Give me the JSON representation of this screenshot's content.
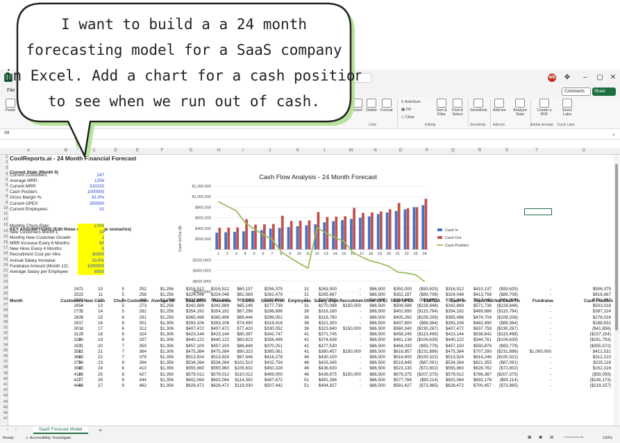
{
  "bubble": {
    "lines": [
      "I want to build a a 24 month",
      "forecasting model for a SaaS company",
      "in Excel. Add a chart for a cash position",
      "to see when we run out of cash."
    ]
  },
  "window": {
    "avatar": "WB",
    "comments": "Comments",
    "share": "Share",
    "file_menu": "File",
    "namebox": "S9"
  },
  "ribbon": {
    "paste": "Paste",
    "insert": "Insert",
    "delete": "Delete",
    "format": "Format",
    "cells": "Cells",
    "autosum": "AutoSum",
    "fill": "Fill",
    "clear": "Clear",
    "sort_filter": "Sort & Filter",
    "find_select": "Find & Select",
    "editing": "Editing",
    "sensitivity": "Sensitivity",
    "sensitivity_group": "Sensitivity",
    "addins": "Add-ins",
    "addins_group": "Add-ins",
    "analyze": "Analyze Data",
    "create_pdf": "Create a PDF",
    "excel_labs": "Excel Labs",
    "adobe_group": "Adobe Acrobat",
    "labs_group": "Excel Labs"
  },
  "columns": [
    "A",
    "B",
    "C",
    "D",
    "E",
    "F",
    "G",
    "H",
    "I",
    "J",
    "K",
    "L",
    "M",
    "N",
    "O",
    "P",
    "Q",
    "R",
    "S",
    "T",
    "U"
  ],
  "title": "CoolReports.ai - 24 Month Financial Forecast",
  "current_state": {
    "heading": "Current State (Month 0)",
    "rows": [
      {
        "label": "Current Customers:",
        "value": "247"
      },
      {
        "label": "Average MRR:",
        "value": "1256"
      },
      {
        "label": "Current MRR:",
        "value": "310232"
      },
      {
        "label": "Cash Position:",
        "value": "1000000"
      },
      {
        "label": "Gross Margin %:",
        "value": "81.0%"
      },
      {
        "label": "Current OPEX:",
        "value": "350000"
      },
      {
        "label": "Current Employees:",
        "value": "31"
      }
    ]
  },
  "assumptions": {
    "heading": "KEY ASSUMPTIONS (Edit these cells to change scenarios)",
    "rows": [
      {
        "label": "Monthly Churn Rate:",
        "value": "2.0%"
      },
      {
        "label": "New Customers Month 1:",
        "value": "10"
      },
      {
        "label": "Monthly New Customer Growth:",
        "value": "1"
      },
      {
        "label": "MRR Increase Every 6 Months:",
        "value": "50"
      },
      {
        "label": "New Hires Every 4 Months:",
        "value": "5"
      },
      {
        "label": "Recruitment Cost per Hire:",
        "value": "30000"
      },
      {
        "label": "Annual Salary Increase:",
        "value": "10.0%"
      },
      {
        "label": "Fundraise Amount (Month 12):",
        "value": "1000000"
      },
      {
        "label": "Average Salary per Employee:",
        "value": "8500"
      }
    ]
  },
  "table": {
    "headers": [
      "Month",
      "Customers",
      "New Custon",
      "Churn",
      "Customers",
      "Average MF",
      "Total MRR",
      "Revenue",
      "COGS",
      "Gross Profi",
      "Employees",
      "Salary Expe",
      "Recruitmen",
      "Other OPEX",
      "Total OPEX",
      "EBITDA",
      "Cash In",
      "Cash Out",
      "Net Cash Flc",
      "Fundraise",
      "Cash Position"
    ],
    "rows": [
      [
        "1",
        "247",
        "10",
        "5",
        "252",
        "$1,256",
        "$316,512",
        "$316,512",
        "$60,137",
        "$256,375",
        "31",
        "$263,500",
        "-",
        "$86,500",
        "$350,000",
        "($93,625)",
        "$316,512",
        "$410,137",
        "($93,625)",
        "-",
        "$906,375"
      ],
      [
        "2",
        "252",
        "11",
        "5",
        "258",
        "$1,256",
        "$324,048",
        "$324,048",
        "$61,569",
        "$262,479",
        "31",
        "$265,687",
        "-",
        "$86,500",
        "$352,187",
        "($89,708)",
        "$324,048",
        "$413,756",
        "($89,708)",
        "-",
        "$816,667"
      ],
      [
        "3",
        "258",
        "12",
        "5",
        "265",
        "$1,256",
        "$332,840",
        "$332,840",
        "$63,240",
        "$269,600",
        "31",
        "$267,900",
        "-",
        "$86,500",
        "$354,400",
        "($84,800)",
        "$332,840",
        "$417,640",
        "($84,800)",
        "-",
        "$731,867"
      ],
      [
        "4",
        "265",
        "13",
        "5",
        "273",
        "$1,256",
        "$342,888",
        "$342,888",
        "$65,149",
        "$277,739",
        "31",
        "$270,088",
        "$150,000",
        "$86,500",
        "$506,588",
        "($228,848)",
        "$342,888",
        "$571,736",
        "($228,848)",
        "-",
        "$503,018"
      ],
      [
        "5",
        "273",
        "14",
        "5",
        "282",
        "$1,256",
        "$354,192",
        "$354,192",
        "$67,296",
        "$286,896",
        "36",
        "$316,190",
        "-",
        "$86,500",
        "$402,690",
        "($115,794)",
        "$354,192",
        "$469,986",
        "($115,794)",
        "-",
        "$387,224"
      ],
      [
        "6",
        "282",
        "15",
        "6",
        "291",
        "$1,256",
        "$365,496",
        "$365,496",
        "$69,444",
        "$296,052",
        "36",
        "$318,760",
        "-",
        "$86,500",
        "$405,260",
        "($109,208)",
        "$365,496",
        "$474,704",
        "($109,208)",
        "-",
        "$278,016"
      ],
      [
        "7",
        "291",
        "16",
        "6",
        "301",
        "$1,306",
        "$393,106",
        "$393,106",
        "$74,690",
        "$318,416",
        "36",
        "$321,300",
        "-",
        "$86,500",
        "$407,800",
        "($89,384)",
        "$393,106",
        "$482,490",
        "($89,384)",
        "-",
        "$188,631"
      ],
      [
        "8",
        "301",
        "17",
        "6",
        "312",
        "$1,306",
        "$407,472",
        "$407,472",
        "$77,420",
        "$330,052",
        "36",
        "$323,840",
        "$150,000",
        "$86,500",
        "$560,340",
        "($230,287)",
        "$407,472",
        "$637,759",
        "($230,287)",
        "-",
        "($41,656)"
      ],
      [
        "9",
        "312",
        "18",
        "6",
        "324",
        "$1,306",
        "$423,144",
        "$423,144",
        "$80,397",
        "$342,747",
        "41",
        "$371,745",
        "-",
        "$86,500",
        "$458,245",
        "($115,498)",
        "$423,144",
        "$538,642",
        "($115,498)",
        "-",
        "($157,154)"
      ],
      [
        "10",
        "324",
        "19",
        "6",
        "337",
        "$1,306",
        "$440,122",
        "$440,122",
        "$83,623",
        "$356,499",
        "41",
        "$374,638",
        "-",
        "$86,500",
        "$461,138",
        "($104,639)",
        "$440,122",
        "$544,761",
        "($104,639)",
        "-",
        "($261,793)"
      ],
      [
        "11",
        "337",
        "20",
        "7",
        "350",
        "$1,306",
        "$457,100",
        "$457,100",
        "$86,849",
        "$370,251",
        "41",
        "$377,530",
        "-",
        "$86,500",
        "$464,030",
        "($93,779)",
        "$457,100",
        "$550,879",
        "($93,779)",
        "-",
        "($355,572)"
      ],
      [
        "12",
        "350",
        "21",
        "7",
        "364",
        "$1,306",
        "$475,384",
        "$475,384",
        "$90,323",
        "$385,061",
        "41",
        "$380,457",
        "$150,000",
        "$86,500",
        "$616,957",
        "($231,896)",
        "$475,384",
        "$707,280",
        "($231,896)",
        "$1,000,000",
        "$412,531"
      ],
      [
        "13",
        "364",
        "22",
        "7",
        "379",
        "$1,356",
        "$513,924",
        "$513,924",
        "$97,646",
        "$416,278",
        "46",
        "$430,100",
        "-",
        "$86,500",
        "$516,600",
        "($100,322)",
        "$513,924",
        "$614,246",
        "($100,322)",
        "-",
        "$312,210"
      ],
      [
        "14",
        "379",
        "23",
        "8",
        "394",
        "$1,356",
        "$534,264",
        "$534,264",
        "$101,510",
        "$432,754",
        "46",
        "$433,345",
        "-",
        "$86,500",
        "$519,845",
        "($87,091)",
        "$534,264",
        "$621,355",
        "($87,091)",
        "-",
        "$225,118"
      ],
      [
        "15",
        "394",
        "24",
        "8",
        "410",
        "$1,356",
        "$555,960",
        "$555,960",
        "$105,632",
        "$450,328",
        "46",
        "$436,630",
        "-",
        "$86,500",
        "$523,130",
        "($72,802)",
        "$555,960",
        "$628,762",
        "($72,802)",
        "-",
        "$152,316"
      ],
      [
        "16",
        "410",
        "25",
        "8",
        "427",
        "$1,356",
        "$579,012",
        "$579,012",
        "$110,012",
        "$469,000",
        "46",
        "$439,875",
        "$150,000",
        "$86,500",
        "$676,375",
        "($207,375)",
        "$579,012",
        "$786,387",
        "($207,375)",
        "-",
        "($55,059)"
      ],
      [
        "17",
        "427",
        "26",
        "9",
        "444",
        "$1,356",
        "$602,064",
        "$602,064",
        "$114,392",
        "$487,672",
        "51",
        "$491,286",
        "-",
        "$86,500",
        "$577,786",
        "($90,114)",
        "$602,064",
        "$692,178",
        "($90,114)",
        "-",
        "($145,173)"
      ],
      [
        "18",
        "444",
        "27",
        "9",
        "462",
        "$1,356",
        "$626,472",
        "$626,472",
        "$119,030",
        "$507,442",
        "51",
        "$494,927",
        "-",
        "$86,500",
        "$581,427",
        "($73,985)",
        "$626,472",
        "$700,457",
        "($73,985)",
        "-",
        "($219,157)"
      ]
    ]
  },
  "chart_data": {
    "type": "bar",
    "title": "Cash Flow Analysis - 24 Month Forecast",
    "ylabel": "Cash In/Out ($)",
    "xlabel": "",
    "categories": [
      "1",
      "2",
      "3",
      "4",
      "5",
      "6",
      "7",
      "8",
      "9",
      "10",
      "11",
      "12",
      "13",
      "14",
      "15",
      "16",
      "17",
      "18",
      "19",
      "20",
      "21",
      "22",
      "23",
      "24"
    ],
    "ylim": [
      -800000,
      1200000
    ],
    "yticks": [
      "$1,200,000",
      "$1,000,000",
      "$800,000",
      "$600,000",
      "$400,000",
      "$200,000",
      "-",
      "($200,000)",
      "($400,000)",
      "($600,000)",
      "($800,000)"
    ],
    "legend_position": "right",
    "series": [
      {
        "name": "Cash In",
        "kind": "bar",
        "color": "#4472c4",
        "values": [
          316512,
          324048,
          332840,
          342888,
          354192,
          365496,
          393106,
          407472,
          423144,
          440122,
          457100,
          475384,
          513924,
          534264,
          555960,
          579012,
          602064,
          626472,
          670000,
          700000,
          730000,
          760000,
          800000,
          840000
        ]
      },
      {
        "name": "Cash Out",
        "kind": "bar",
        "color": "#c0504d",
        "values": [
          410137,
          413756,
          417640,
          571736,
          469986,
          474704,
          482490,
          637759,
          538642,
          544761,
          550879,
          707280,
          614246,
          621355,
          628762,
          786387,
          692178,
          700457,
          720000,
          760000,
          880000,
          780000,
          800000,
          960000
        ]
      },
      {
        "name": "Cash Position",
        "kind": "line",
        "color": "#9bbb59",
        "values": [
          906375,
          816667,
          731867,
          503018,
          387224,
          278016,
          188631,
          -41656,
          -157154,
          -261793,
          -355572,
          412531,
          312210,
          225118,
          152316,
          -55059,
          -145173,
          -219157,
          -260000,
          -320000,
          -430000,
          -450000,
          -480000,
          -610000
        ]
      }
    ]
  },
  "sheet_tab": "SaaS Forecast Model",
  "status": {
    "ready": "Ready",
    "accessibility": "Accessibility: Investigate",
    "zoom": "100%"
  }
}
